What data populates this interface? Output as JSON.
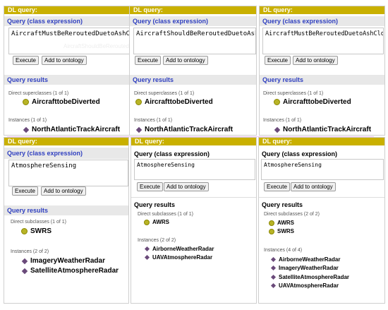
{
  "window_title": "DL query:",
  "labels": {
    "query": "Query (class expression)",
    "execute": "Execute",
    "add": "Add to ontology",
    "results": "Query results",
    "superclasses_1": "Direct superclasses (1 of 1)",
    "subclasses_1": "Direct subclasses (1 of 1)",
    "subclasses_2": "Direct subclasses (2 of 2)",
    "instances_1": "Instances (1 of 1)",
    "instances_2": "Instances (2 of 2)",
    "instances_4": "Instances (4 of 4)"
  },
  "top": {
    "left": {
      "query_text": "AircraftMustBeReroutedDuetoAshCloud",
      "ghost_text": "AircraftShouldBeReroutedDuetoAshCloud",
      "superclass": "AircrafttobeDiverted",
      "instance": "NorthAtlanticTrackAircraft"
    },
    "mid": {
      "query_text": "AircraftShouldBeReroutedDuetoAshCloud",
      "superclass": "AircrafttobeDiverted",
      "instance": "NorthAtlanticTrackAircraft"
    },
    "right": {
      "query_text": "AircraftMustBeReroutedDuetoAshCloud",
      "superclass": "AircrafttobeDiverted",
      "instance": "NorthAtlanticTrackAircraft"
    }
  },
  "bottom": {
    "left": {
      "query_text": "AtmosphereSensing",
      "subclasses": [
        "SWRS"
      ],
      "instances": [
        "ImageryWeatherRadar",
        "SatelliteAtmosphereRadar"
      ]
    },
    "mid": {
      "query_text": "AtmosphereSensing",
      "subclasses": [
        "AWRS"
      ],
      "instances": [
        "AirborneWeatherRadar",
        "UAVAtmosphereRadar"
      ]
    },
    "right": {
      "query_text": "AtmosphereSensing",
      "subclasses": [
        "AWRS",
        "SWRS"
      ],
      "instances": [
        "AirborneWeatherRadar",
        "ImageryWeatherRadar",
        "SatelliteAtmosphereRadar",
        "UAVAtmosphereRadar"
      ]
    }
  },
  "colors": {
    "title_bar": "#c9b000",
    "section_blue": "#3040c0",
    "class_circle": "#b8b426",
    "instance_diamond": "#6a4a7a"
  }
}
